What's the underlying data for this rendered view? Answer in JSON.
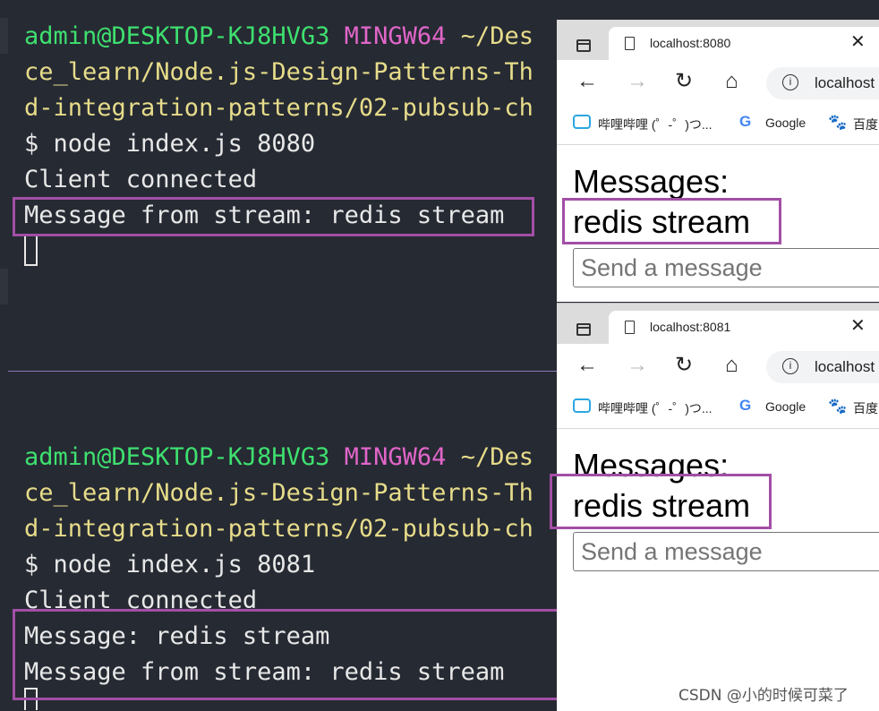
{
  "terminal_top": {
    "prompt_user": "admin@DESKTOP-KJ8HVG3",
    "prompt_env": "MINGW64",
    "path_line1": "~/Des",
    "path_line2": "ce_learn/Node.js-Design-Patterns-Th",
    "path_line3": "d-integration-patterns/02-pubsub-ch",
    "command": "$ node index.js 8080",
    "output_1": "Client connected",
    "output_2": "Message from stream: redis stream"
  },
  "terminal_bottom": {
    "prompt_user": "admin@DESKTOP-KJ8HVG3",
    "prompt_env": "MINGW64",
    "path_line1": "~/Des",
    "path_line2": "ce_learn/Node.js-Design-Patterns-Th",
    "path_line3": "d-integration-patterns/02-pubsub-ch",
    "command": "$ node index.js 8081",
    "output_1": "Client connected",
    "output_2": "Message: redis stream",
    "output_3": "Message from stream: redis stream"
  },
  "browser_1": {
    "tab_title": "localhost:8080",
    "address": "localhost",
    "bookmarks": [
      "哔哩哔哩 (゜-゜)つ...",
      "Google",
      "百度"
    ],
    "heading": "Messages:",
    "messages": [
      "redis stream"
    ],
    "input_placeholder": "Send a message"
  },
  "browser_2": {
    "tab_title": "localhost:8081",
    "address": "localhost",
    "bookmarks": [
      "哔哩哔哩 (゜-゜)つ...",
      "Google",
      "百度"
    ],
    "heading": "Messages:",
    "messages": [
      "redis stream"
    ],
    "input_placeholder": "Send a message"
  },
  "watermark": "CSDN @小的时候可菜了",
  "colors": {
    "terminal_bg": "#262a33",
    "prompt_user": "#3ee06f",
    "prompt_env": "#e166c9",
    "path": "#e7dc8a",
    "highlight_box": "#a24fa6"
  },
  "icons": [
    "window-icon",
    "page-icon",
    "close-icon",
    "back-arrow-icon",
    "forward-arrow-icon",
    "reload-icon",
    "home-icon",
    "info-icon",
    "bilibili-icon",
    "google-icon",
    "baidu-icon"
  ]
}
